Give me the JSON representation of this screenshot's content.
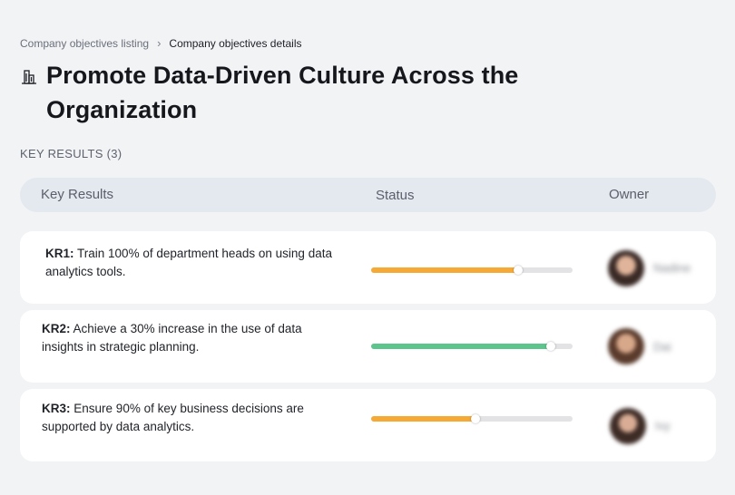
{
  "breadcrumb": {
    "items": [
      "Company objectives listing",
      "Company objectives details"
    ],
    "separator": "›"
  },
  "page": {
    "title": "Promote Data-Driven Culture Across the Organization",
    "title_icon": "building-icon",
    "section_label": "KEY RESULTS (3)"
  },
  "table": {
    "columns": [
      "Key Results",
      "Status",
      "Owner"
    ],
    "rows": [
      {
        "id": "KR1:",
        "text": "Train 100% of department heads on using data analytics tools.",
        "progress": 0.73,
        "color": "#f6a935",
        "owner": "Nadine"
      },
      {
        "id": "KR2:",
        "text": "Achieve a 30% increase in the use of data insights in strategic planning.",
        "progress": 0.89,
        "color": "#5cc58d",
        "owner": "Dai"
      },
      {
        "id": "KR3:",
        "text": "Ensure 90% of key business decisions are supported by data analytics.",
        "progress": 0.52,
        "color": "#f6a935",
        "owner": "Ivy"
      }
    ]
  }
}
